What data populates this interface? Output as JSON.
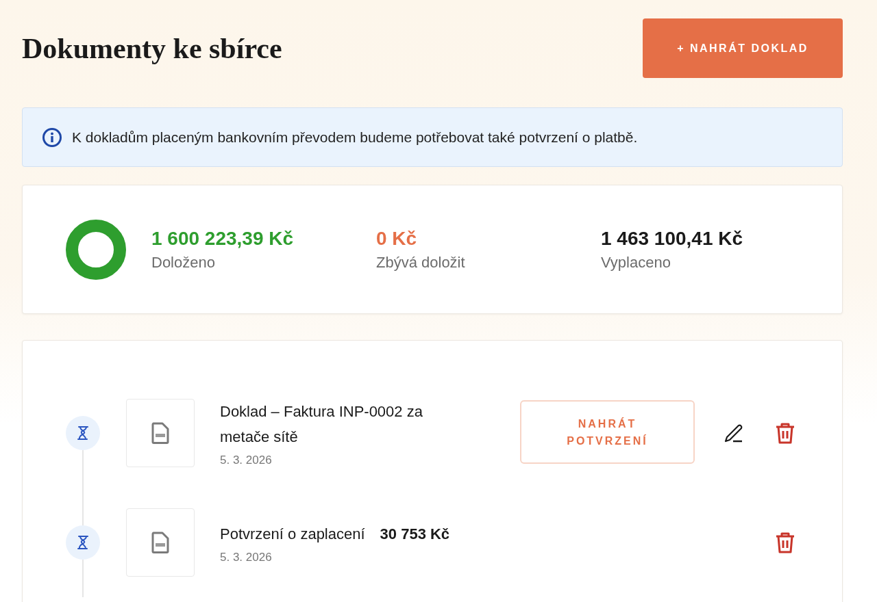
{
  "page": {
    "title": "Dokumenty ke sbírce",
    "upload_button": "+ NAHRÁT DOKLAD"
  },
  "info": {
    "text": "K dokladům placeným bankovním převodem budeme potřebovat také potvrzení o platbě."
  },
  "summary": {
    "level": 1,
    "stats": [
      {
        "value": "1 600 223,39 Kč",
        "label": "Doloženo",
        "color": "#2e9e2e"
      },
      {
        "value": "0 Kč",
        "label": "Zbývá doložit",
        "color": "#e56f47"
      },
      {
        "value": "1 463 100,41 Kč",
        "label": "Vyplaceno",
        "color": "#1a1a1a"
      }
    ]
  },
  "documents": [
    {
      "title": "Doklad – Faktura INP-0002 za metače sítě",
      "date": "5. 3. 2026",
      "upload_label": "NAHRÁT POTVRZENÍ",
      "editable": true
    },
    {
      "title": "Potvrzení o zaplacení",
      "amount": "30 753 Kč",
      "date": "5. 3. 2026",
      "editable": false
    }
  ]
}
